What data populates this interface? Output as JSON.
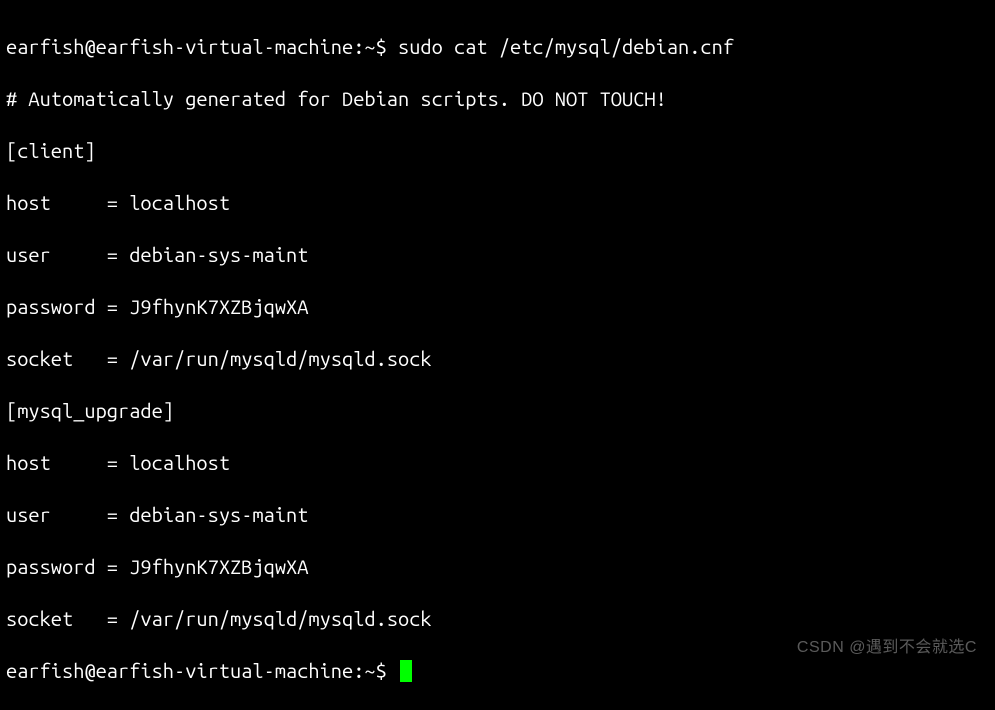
{
  "prompt1": {
    "user_host": "earfish@earfish-virtual-machine",
    "path": "~",
    "symbol": "$",
    "command": "sudo cat /etc/mysql/debian.cnf"
  },
  "file_output": {
    "comment": "# Automatically generated for Debian scripts. DO NOT TOUCH!",
    "sections": [
      {
        "header": "[client]",
        "entries": [
          {
            "key": "host    ",
            "value": "localhost"
          },
          {
            "key": "user    ",
            "value": "debian-sys-maint"
          },
          {
            "key": "password",
            "value": "J9fhynK7XZBjqwXA"
          },
          {
            "key": "socket  ",
            "value": "/var/run/mysqld/mysqld.sock"
          }
        ]
      },
      {
        "header": "[mysql_upgrade]",
        "entries": [
          {
            "key": "host    ",
            "value": "localhost"
          },
          {
            "key": "user    ",
            "value": "debian-sys-maint"
          },
          {
            "key": "password",
            "value": "J9fhynK7XZBjqwXA"
          },
          {
            "key": "socket  ",
            "value": "/var/run/mysqld/mysqld.sock"
          }
        ]
      }
    ]
  },
  "prompt2": {
    "user_host": "earfish@earfish-virtual-machine",
    "path": "~",
    "symbol": "$"
  },
  "watermark": "CSDN @遇到不会就选C"
}
